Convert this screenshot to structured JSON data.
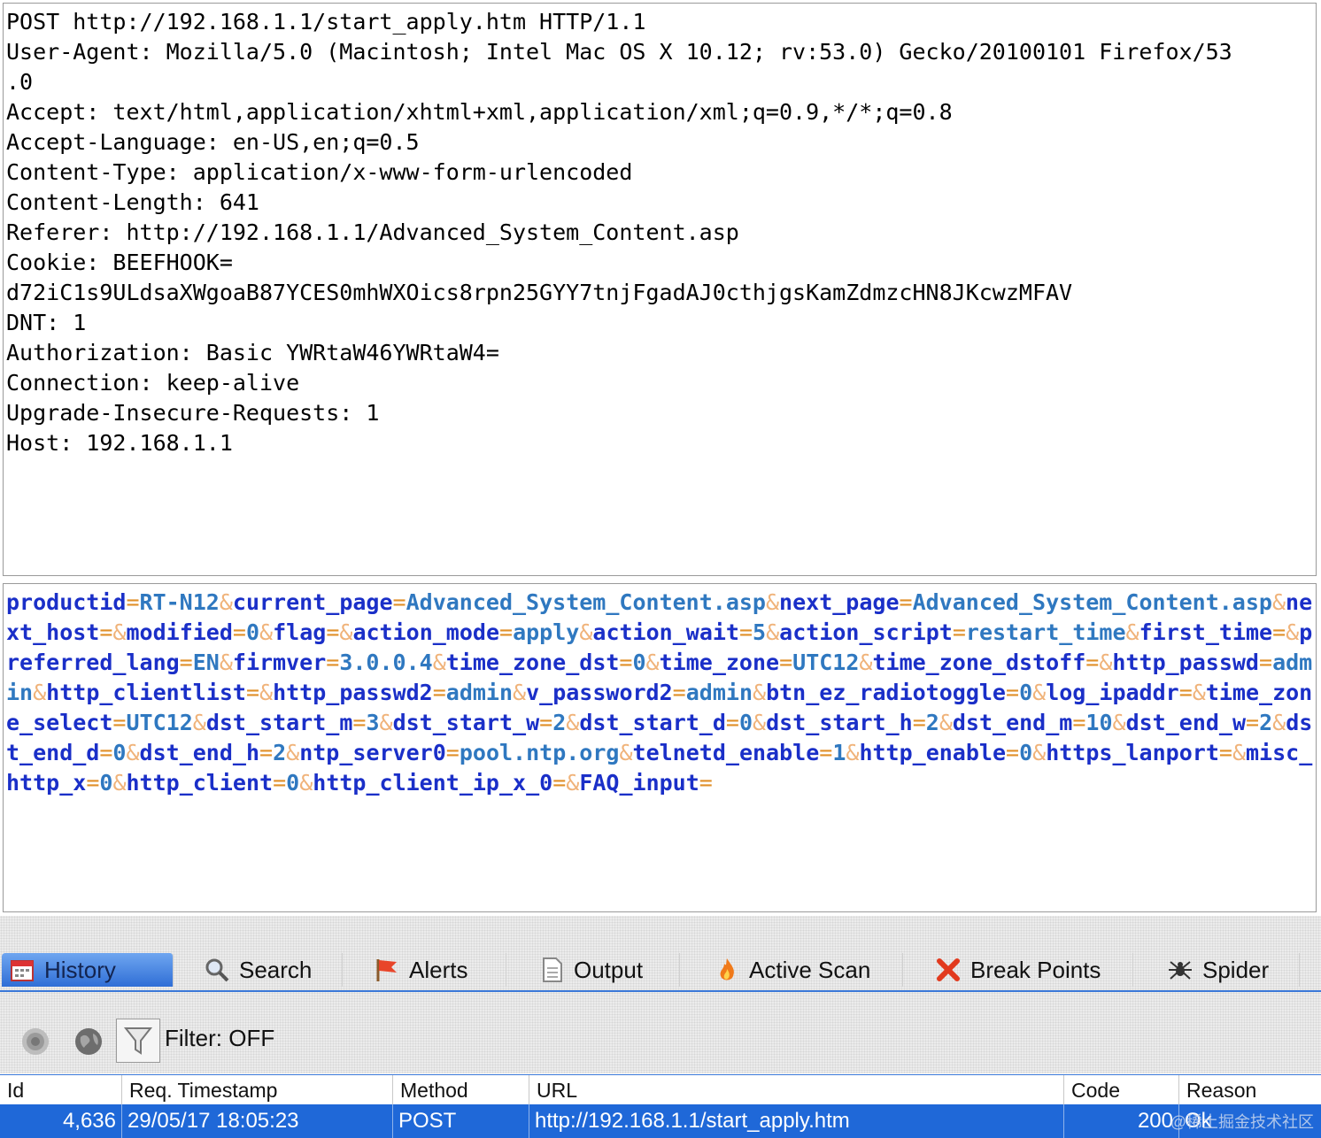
{
  "request_headers": [
    "POST http://192.168.1.1/start_apply.htm HTTP/1.1",
    "User-Agent: Mozilla/5.0 (Macintosh; Intel Mac OS X 10.12; rv:53.0) Gecko/20100101 Firefox/53",
    ".0",
    "Accept: text/html,application/xhtml+xml,application/xml;q=0.9,*/*;q=0.8",
    "Accept-Language: en-US,en;q=0.5",
    "Content-Type: application/x-www-form-urlencoded",
    "Content-Length: 641",
    "Referer: http://192.168.1.1/Advanced_System_Content.asp",
    "Cookie: BEEFHOOK=",
    "d72iC1s9ULdsaXWgoaB87YCES0mhWXOics8rpn25GYY7tnjFgadAJ0cthjgsKamZdmzcHN8JKcwzMFAV",
    "DNT: 1",
    "Authorization: Basic YWRtaW46YWRtaW4=",
    "Connection: keep-alive",
    "Upgrade-Insecure-Requests: 1",
    "Host: 192.168.1.1"
  ],
  "request_body": [
    {
      "key": "productid",
      "value": "RT-N12"
    },
    {
      "key": "current_page",
      "value": "Advanced_System_Content.asp"
    },
    {
      "key": "next_page",
      "value": "Advanced_System_Content.asp"
    },
    {
      "key": "next_host",
      "value": ""
    },
    {
      "key": "modified",
      "value": "0"
    },
    {
      "key": "flag",
      "value": ""
    },
    {
      "key": "action_mode",
      "value": "apply"
    },
    {
      "key": "action_wait",
      "value": "5"
    },
    {
      "key": "action_script",
      "value": "restart_time"
    },
    {
      "key": "first_time",
      "value": ""
    },
    {
      "key": "preferred_lang",
      "value": "EN"
    },
    {
      "key": "firmver",
      "value": "3.0.0.4"
    },
    {
      "key": "time_zone_dst",
      "value": "0"
    },
    {
      "key": "time_zone",
      "value": "UTC12"
    },
    {
      "key": "time_zone_dstoff",
      "value": ""
    },
    {
      "key": "http_passwd",
      "value": "admin"
    },
    {
      "key": "http_clientlist",
      "value": ""
    },
    {
      "key": "http_passwd2",
      "value": "admin"
    },
    {
      "key": "v_password2",
      "value": "admin"
    },
    {
      "key": "btn_ez_radiotoggle",
      "value": "0"
    },
    {
      "key": "log_ipaddr",
      "value": ""
    },
    {
      "key": "time_zone_select",
      "value": "UTC12"
    },
    {
      "key": "dst_start_m",
      "value": "3"
    },
    {
      "key": "dst_start_w",
      "value": "2"
    },
    {
      "key": "dst_start_d",
      "value": "0"
    },
    {
      "key": "dst_start_h",
      "value": "2"
    },
    {
      "key": "dst_end_m",
      "value": "10"
    },
    {
      "key": "dst_end_w",
      "value": "2"
    },
    {
      "key": "dst_end_d",
      "value": "0"
    },
    {
      "key": "dst_end_h",
      "value": "2"
    },
    {
      "key": "ntp_server0",
      "value": "pool.ntp.org"
    },
    {
      "key": "telnetd_enable",
      "value": "1"
    },
    {
      "key": "http_enable",
      "value": "0"
    },
    {
      "key": "https_lanport",
      "value": ""
    },
    {
      "key": "misc_http_x",
      "value": "0"
    },
    {
      "key": "http_client",
      "value": "0"
    },
    {
      "key": "http_client_ip_x_0",
      "value": ""
    },
    {
      "key": "FAQ_input",
      "value": ""
    }
  ],
  "tabs": [
    {
      "label": "History",
      "icon": "calendar-icon",
      "active": true
    },
    {
      "label": "Search",
      "icon": "magnifier-icon",
      "active": false
    },
    {
      "label": "Alerts",
      "icon": "flag-icon",
      "active": false
    },
    {
      "label": "Output",
      "icon": "document-icon",
      "active": false
    },
    {
      "label": "Active Scan",
      "icon": "flame-icon",
      "active": false
    },
    {
      "label": "Break Points",
      "icon": "red-x-icon",
      "active": false
    },
    {
      "label": "Spider",
      "icon": "spider-icon",
      "active": false
    }
  ],
  "toolbar": {
    "filter_label": "Filter: OFF",
    "buttons": [
      "target-icon",
      "globe-icon",
      "filter-funnel-icon"
    ]
  },
  "history_table": {
    "columns": [
      "Id",
      "Req. Timestamp",
      "Method",
      "URL",
      "Code",
      "Reason"
    ],
    "rows": [
      {
        "id": "4,636",
        "timestamp": "29/05/17 18:05:23",
        "method": "POST",
        "url": "http://192.168.1.1/start_apply.htm",
        "code": "200",
        "reason": "Ok",
        "selected": true
      }
    ]
  },
  "watermark": "@稀土掘金技术社区",
  "colors": {
    "body_key": "#1a2fc8",
    "body_value": "#2f78c0",
    "body_separator": "#e0902a",
    "selection": "#1f68d8"
  }
}
